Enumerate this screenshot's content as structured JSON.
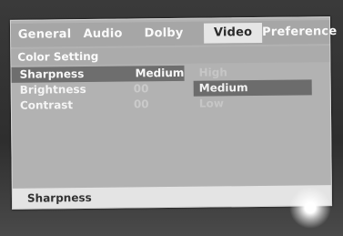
{
  "tabs": [
    {
      "label": "General",
      "active": false
    },
    {
      "label": "Audio",
      "active": false
    },
    {
      "label": "Dolby",
      "active": false
    },
    {
      "label": "Video",
      "active": true
    },
    {
      "label": "Preference",
      "active": false
    }
  ],
  "section_title": "Color Setting",
  "settings": [
    {
      "name": "Sharpness",
      "value": "Medium",
      "selected": true
    },
    {
      "name": "Brightness",
      "value": "00",
      "selected": false
    },
    {
      "name": "Contrast",
      "value": "00",
      "selected": false
    }
  ],
  "options": [
    {
      "label": "High",
      "highlighted": false
    },
    {
      "label": "Medium",
      "highlighted": true
    },
    {
      "label": "Low",
      "highlighted": false
    }
  ],
  "status": {
    "label": "Sharpness"
  },
  "colors": {
    "panel": "#b2b2b2",
    "selection": "#6e6e6e",
    "active_tab": "#e6e6e6"
  }
}
